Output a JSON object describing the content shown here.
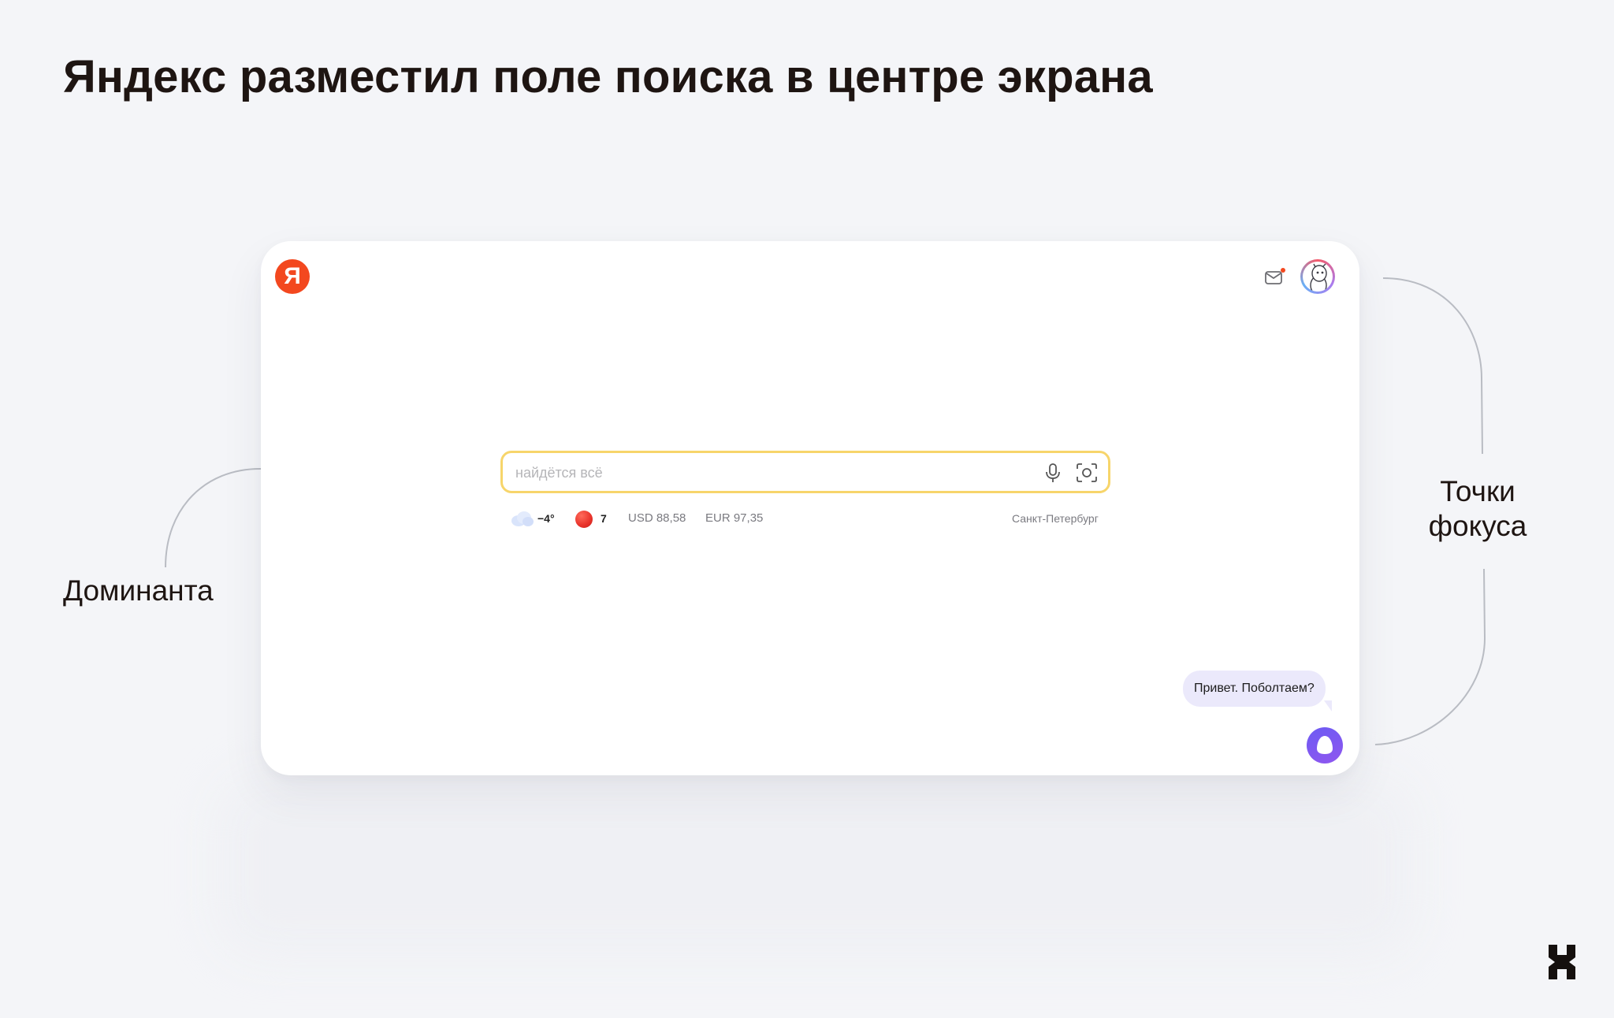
{
  "slide": {
    "title": "Яндекс разместил поле поиска в центре экрана",
    "annotation_left": "Доминанта",
    "annotation_right_line1": "Точки",
    "annotation_right_line2": "фокуса"
  },
  "browser": {
    "logo_letter": "Я",
    "mail_icon": "mail-icon",
    "avatar_icon": "avatar-icon",
    "search": {
      "placeholder": "найдётся всё",
      "value": "",
      "mic_icon": "microphone-icon",
      "camera_icon": "camera-search-icon",
      "border_color": "#f7d56b"
    },
    "info": {
      "weather_temp": "−4°",
      "traffic_score": "7",
      "usd": "USD 88,58",
      "eur": "EUR 97,35",
      "city": "Санкт-Петербург"
    },
    "alice": {
      "greeting": "Привет. Поболтаем?",
      "button_icon": "alice-icon"
    }
  },
  "colors": {
    "background": "#f4f5f8",
    "yandex_red": "#f3481f",
    "alice_purple": "#6d5bf3",
    "alice_bubble": "#ebe9fb"
  }
}
